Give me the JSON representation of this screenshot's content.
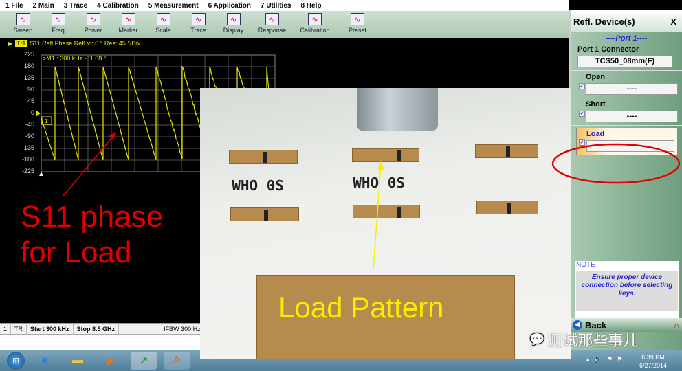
{
  "menu": [
    "1 File",
    "2 Main",
    "3 Trace",
    "4 Calibration",
    "5 Measurement",
    "6 Application",
    "7 Utilities",
    "8 Help"
  ],
  "toolbar": [
    {
      "label": "Sweep",
      "icon": "sweep-icon"
    },
    {
      "label": "Freq",
      "icon": "freq-icon"
    },
    {
      "label": "Power",
      "icon": "power-icon"
    },
    {
      "label": "Marker",
      "icon": "marker-icon"
    },
    {
      "label": "Scale",
      "icon": "scale-icon"
    },
    {
      "label": "Trace",
      "icon": "trace-icon"
    },
    {
      "label": "Display",
      "icon": "display-icon"
    },
    {
      "label": "Response",
      "icon": "response-icon"
    },
    {
      "label": "Calibration",
      "icon": "wrench-icon"
    },
    {
      "label": "Preset",
      "icon": "home-icon"
    }
  ],
  "trace": {
    "tag": "Tr1",
    "header": "S11 Refl Phase RefLvl: 0 ° Res: 45 °/Div",
    "marker": ">M1  :  300 kHz  -71.68 °",
    "marker_id": "1",
    "yticks": [
      "225",
      "180",
      "135",
      "90",
      "45",
      "0",
      "-45",
      "-90",
      "-135",
      "-180",
      "-225"
    ],
    "trace_color": "#e8e800"
  },
  "status": {
    "channel": "1",
    "mode": "TR",
    "start": "Start 300 kHz",
    "stop": "Stop 8.5 GHz",
    "ifbw": "IFBW 300 Hz"
  },
  "panel": {
    "title": "Refl. Device(s)",
    "close": "X",
    "port": "----Port 1----",
    "connector_label": "Port 1 Connector",
    "connector_value": "TCS50_08mm(F)",
    "items": [
      {
        "label": "Open",
        "value": "----",
        "checked": true
      },
      {
        "label": "Short",
        "value": "----",
        "checked": true
      },
      {
        "label": "Load",
        "value": "----",
        "checked": true
      }
    ],
    "note_title": "NOTE",
    "note_text": "Ensure proper device connection before selecting keys.",
    "back": "Back"
  },
  "photo": {
    "silk_left": "WHO 0S",
    "silk_mid": "WHO 0S"
  },
  "annotations": {
    "s11_line1": "S11 phase",
    "s11_line2": "for Load",
    "load_pattern": "Load Pattern",
    "red": "#e00000",
    "yellow": "#f5f000"
  },
  "watermark": "测试那些事儿",
  "clock": {
    "time": "6:39 PM",
    "date": "6/27/2014",
    "hidden_time": "6:39 PM"
  }
}
